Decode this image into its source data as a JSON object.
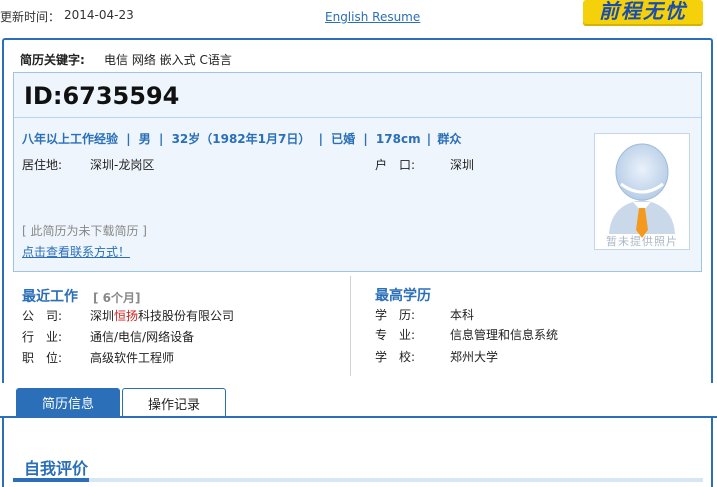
{
  "top": {
    "update_label": "更新时间：",
    "update_date": "2014-04-23",
    "english_link": "English Resume",
    "logo_text": "前程无忧"
  },
  "keywords": {
    "label": "简历关键字:",
    "values": "电信  网络  嵌入式  C语言"
  },
  "resume_id": "ID:6735594",
  "summary": {
    "experience": "八年以上工作经验",
    "gender": "男",
    "age": "32岁（1982年1月7日）",
    "marital": "已婚",
    "height": "178cm",
    "political": "群众",
    "sep": "|"
  },
  "residence": {
    "label": "居住地:",
    "value": "深圳-龙岗区"
  },
  "hukou": {
    "label": "户　口:",
    "value": "深圳"
  },
  "photo_caption": "暂未提供照片",
  "not_downloaded": "[ 此简历为未下载简历 ]",
  "contact_link": "点击查看联系方式！",
  "recent_work": {
    "title": "最近工作",
    "sub": "[ 6个月]",
    "rows": [
      {
        "label": "公　司:",
        "value_pre": "深圳",
        "value_hl": "恒扬",
        "value_post": "科技股份有限公司"
      },
      {
        "label": "行　业:",
        "value": "通信/电信/网络设备"
      },
      {
        "label": "职　位:",
        "value": "高级软件工程师"
      }
    ]
  },
  "education": {
    "title": "最高学历",
    "rows": [
      {
        "label": "学　历:",
        "value": "本科"
      },
      {
        "label": "专　业:",
        "value": "信息管理和信息系统"
      },
      {
        "label": "学　校:",
        "value": "郑州大学"
      }
    ]
  },
  "tabs": [
    {
      "label": "简历信息",
      "active": true
    },
    {
      "label": "操作记录",
      "active": false
    }
  ],
  "self_eval_title": "自我评价",
  "colors": {
    "accent": "#2b6fb8",
    "panel_bg": "#eef5fc",
    "highlight": "#d42020"
  }
}
